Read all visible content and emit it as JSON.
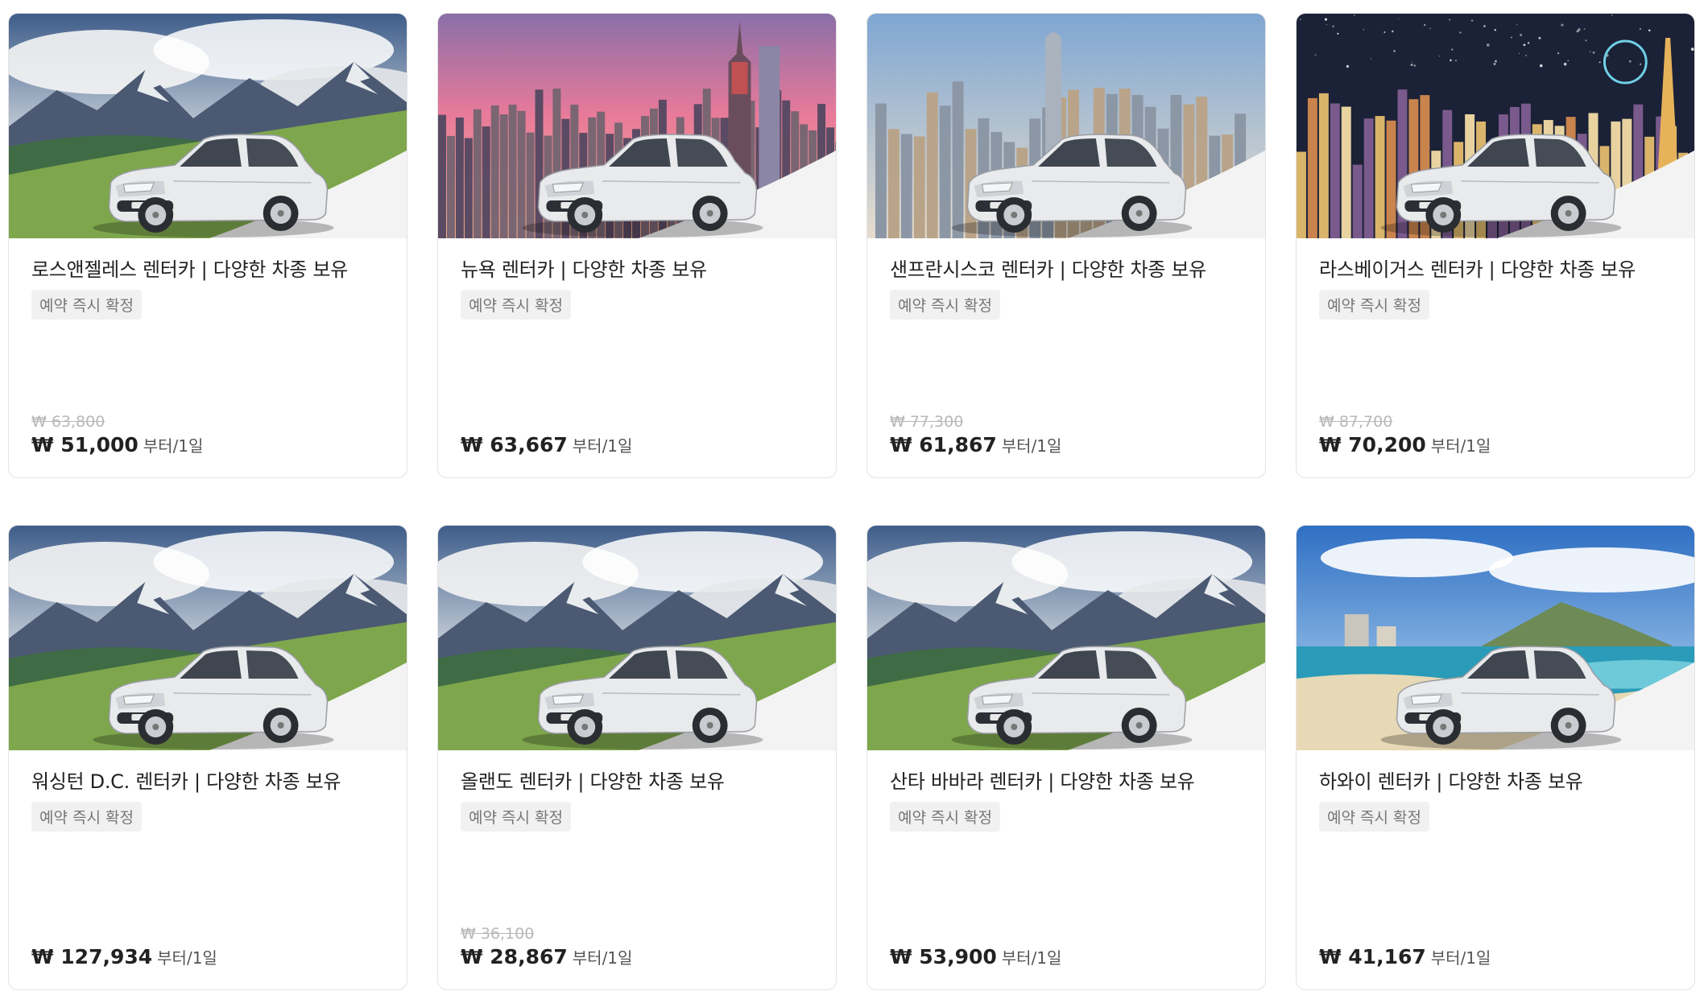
{
  "cards": [
    {
      "title": "로스앤젤레스 렌터카 | 다양한 차종 보유",
      "badge": "예약 즉시 확정",
      "original_price": "₩ 63,800",
      "price": "₩ 51,000",
      "price_unit": "부터/1일",
      "scene": "mountain"
    },
    {
      "title": "뉴욕 렌터카 | 다양한 차종 보유",
      "badge": "예약 즉시 확정",
      "original_price": "",
      "price": "₩ 63,667",
      "price_unit": "부터/1일",
      "scene": "newyork"
    },
    {
      "title": "샌프란시스코 렌터카 | 다양한 차종 보유",
      "badge": "예약 즉시 확정",
      "original_price": "₩ 77,300",
      "price": "₩ 61,867",
      "price_unit": "부터/1일",
      "scene": "sanfrancisco"
    },
    {
      "title": "라스베이거스 렌터카 | 다양한 차종 보유",
      "badge": "예약 즉시 확정",
      "original_price": "₩ 87,700",
      "price": "₩ 70,200",
      "price_unit": "부터/1일",
      "scene": "lasvegas"
    },
    {
      "title": "워싱턴 D.C. 렌터카 | 다양한 차종 보유",
      "badge": "예약 즉시 확정",
      "original_price": "",
      "price": "₩ 127,934",
      "price_unit": "부터/1일",
      "scene": "mountain"
    },
    {
      "title": "올랜도 렌터카 | 다양한 차종 보유",
      "badge": "예약 즉시 확정",
      "original_price": "₩ 36,100",
      "price": "₩ 28,867",
      "price_unit": "부터/1일",
      "scene": "mountain"
    },
    {
      "title": "산타 바바라 렌터카 | 다양한 차종 보유",
      "badge": "예약 즉시 확정",
      "original_price": "",
      "price": "₩ 53,900",
      "price_unit": "부터/1일",
      "scene": "mountain"
    },
    {
      "title": "하와이 렌터카 | 다양한 차종 보유",
      "badge": "예약 즉시 확정",
      "original_price": "",
      "price": "₩ 41,167",
      "price_unit": "부터/1일",
      "scene": "hawaii"
    }
  ]
}
